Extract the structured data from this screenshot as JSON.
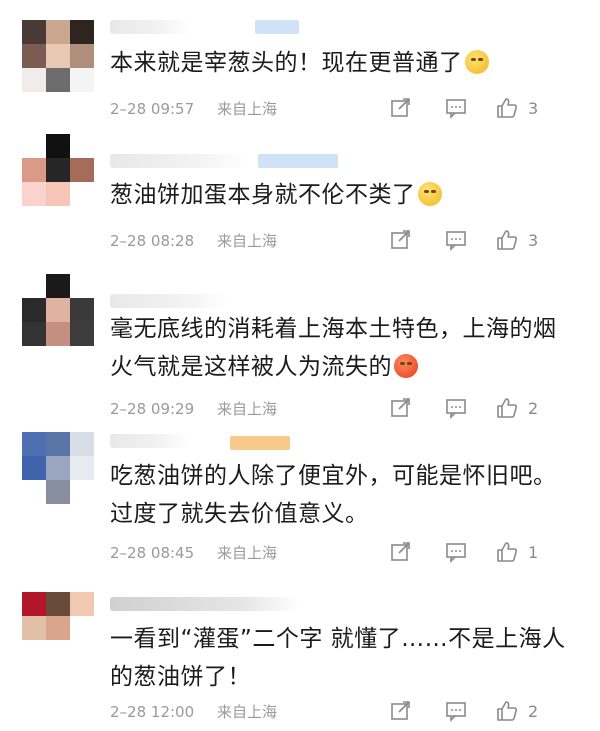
{
  "comments": [
    {
      "text": "本来就是宰葱头的！现在更普通了",
      "emoji": "smirk-emoji",
      "date": "2–28 09:57",
      "source": "来自上海",
      "likes": "3",
      "avatar_colors": [
        "#4a3a36",
        "#c9a88f",
        "#2d2520",
        "#7a5c52",
        "#e7c9b4",
        "#b08e7c",
        "#f1ece9",
        "#6c6c6c",
        "#f4f4f4"
      ]
    },
    {
      "text": "葱油饼加蛋本身就不伦不类了",
      "emoji": "sleepy-emoji",
      "date": "2–28 08:28",
      "source": "来自上海",
      "likes": "3",
      "avatar_colors": [
        "#ffffff",
        "#111111",
        "#ffffff",
        "#d99a87",
        "#262626",
        "#a76b59",
        "#fad3cc",
        "#f7c4b8",
        "#ffffff"
      ]
    },
    {
      "text": "毫无底线的消耗着上海本土特色，上海的烟火气就是这样被人为流失的",
      "emoji": "angry-emoji",
      "date": "2–28 09:29",
      "source": "来自上海",
      "likes": "2",
      "avatar_colors": [
        "#ffffff",
        "#1a1a1a",
        "#ffffff",
        "#2a2a2a",
        "#e0b3a1",
        "#3a3a3a",
        "#333333",
        "#c48f80",
        "#3c3c3c"
      ]
    },
    {
      "text": "吃葱油饼的人除了便宜外，可能是怀旧吧。过度了就失去价值意义。",
      "emoji": "",
      "date": "2–28 08:45",
      "source": "来自上海",
      "likes": "1",
      "avatar_colors": [
        "#4f6fb3",
        "#5a76a8",
        "#d8dde6",
        "#3f64ad",
        "#9aa6c0",
        "#e7eaf0",
        "#ffffff",
        "#8a8fa0",
        "#ffffff"
      ]
    },
    {
      "text": "一看到“灌蛋”二个字 就懂了……不是上海人的葱油饼了！",
      "emoji": "",
      "date": "2–28 12:00",
      "source": "来自上海",
      "likes": "2",
      "avatar_colors": [
        "#b3162a",
        "#6a4a3a",
        "#f0c9b0",
        "#e2c0a8",
        "#d9a58c",
        "#ffffff",
        "#ffffff",
        "#ffffff",
        "#ffffff"
      ]
    }
  ],
  "colors": {
    "meta_text": "#9a9a9a",
    "icon": "#8a8a8a",
    "tag_blue": "#a9ccf0",
    "tag_orange": "#f7c98a"
  }
}
